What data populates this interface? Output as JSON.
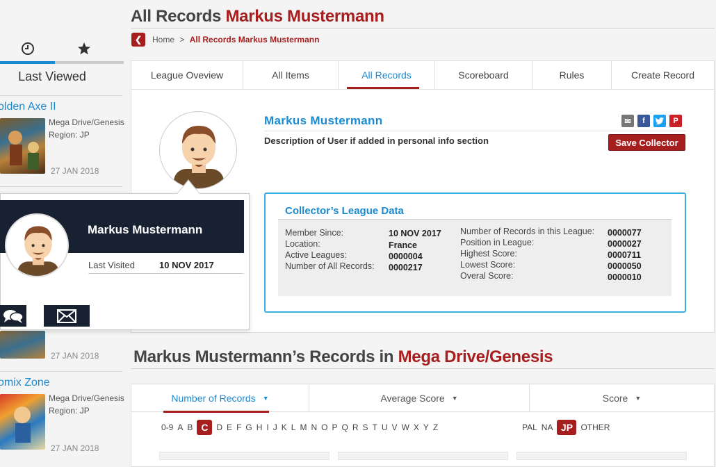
{
  "sidebar": {
    "title": "Last Viewed",
    "tabs": [
      {
        "icon": "clock-icon"
      },
      {
        "icon": "star-icon"
      }
    ],
    "items": [
      {
        "title": "olden Axe II",
        "platform": "Mega Drive/Genesis",
        "region": "Region: JP",
        "date": "27 JAN 2018"
      },
      {
        "title": "",
        "platform": "",
        "region": "",
        "date": "27 JAN 2018"
      },
      {
        "title": "omix Zone",
        "platform": "Mega Drive/Genesis",
        "region": "Region: JP",
        "date": "27 JAN 2018"
      }
    ]
  },
  "page": {
    "title_prefix": "All Records",
    "title_name": "Markus Mustermann",
    "breadcrumb_home": "Home",
    "breadcrumb_sep": ">",
    "breadcrumb_current": "All Records Markus Mustermann"
  },
  "tabs": [
    "League Oveview",
    "All Items",
    "All Records",
    "Scoreboard",
    "Rules",
    "Create Record"
  ],
  "profile": {
    "name": "Markus Mustermann",
    "description": "Description of User if added in personal info section",
    "save_label": "Save Collector",
    "social": [
      "mail-icon",
      "facebook-icon",
      "twitter-icon",
      "pinterest-icon"
    ]
  },
  "league": {
    "title": "Collector’s League Data",
    "left": [
      {
        "label": "Member Since:",
        "value": "10 NOV 2017"
      },
      {
        "label": "Location:",
        "value": "France"
      },
      {
        "label": "Active Leagues:",
        "value": "0000004"
      },
      {
        "label": "Number of All Records:",
        "value": "0000217"
      }
    ],
    "right": [
      {
        "label": "Number of Records in this League:",
        "value": "0000077"
      },
      {
        "label": "Position in League:",
        "value": "0000027"
      },
      {
        "label": "Highest Score:",
        "value": "0000711"
      },
      {
        "label": "Lowest Score:",
        "value": "0000050"
      },
      {
        "label": "Overal Score:",
        "value": "0000010"
      }
    ]
  },
  "popup": {
    "name": "Markus Mustermann",
    "last_visited_label": "Last Visited",
    "last_visited_value": "10 NOV 2017"
  },
  "records": {
    "title_prefix": "Markus Mustermann’s Records in",
    "title_platform": "Mega Drive/Genesis",
    "sort_options": [
      "Number of Records",
      "Average Score",
      "Score"
    ],
    "sort_arrow": "▼",
    "alpha": [
      "0-9",
      "A",
      "B",
      "C",
      "D",
      "E",
      "F",
      "G",
      "H",
      "I",
      "J",
      "K",
      "L",
      "M",
      "N",
      "O",
      "P",
      "Q",
      "R",
      "S",
      "T",
      "U",
      "V",
      "W",
      "X",
      "Y",
      "Z"
    ],
    "alpha_selected": "C",
    "regions": [
      "PAL",
      "NA",
      "JP",
      "OTHER"
    ],
    "region_selected": "JP"
  },
  "colors": {
    "accent_blue": "#1b8ad1",
    "accent_red": "#a61e1e",
    "dark_navy": "#182131"
  }
}
